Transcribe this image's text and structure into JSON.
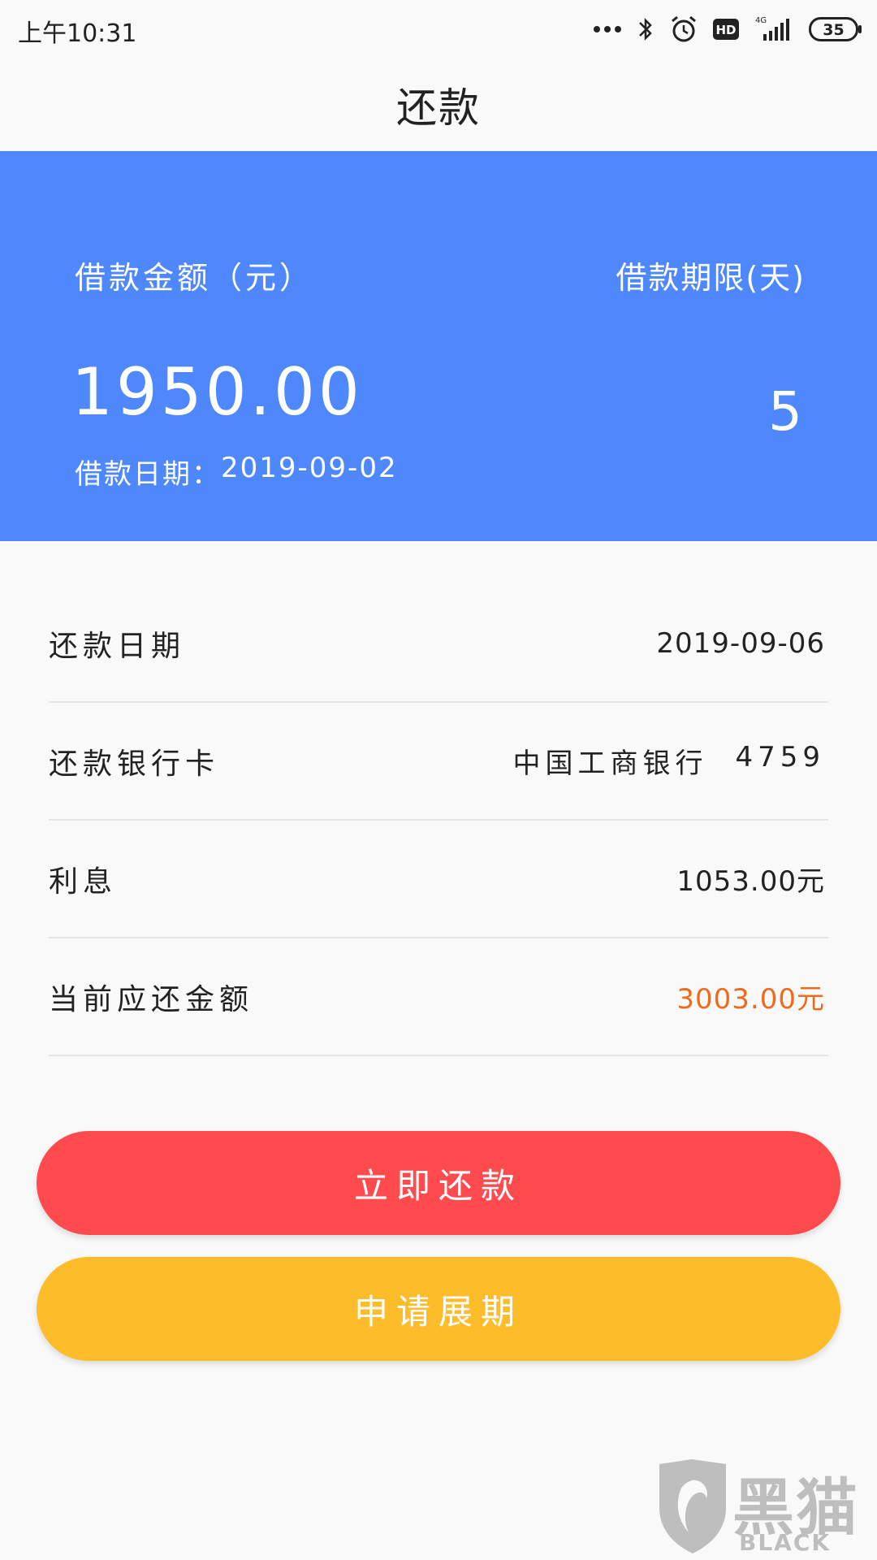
{
  "status_bar": {
    "time": "上午10:31",
    "network": "4G",
    "hd_badge": "HD",
    "battery": "35",
    "icons": [
      "more-dots-icon",
      "bluetooth-icon",
      "alarm-icon",
      "hd-icon",
      "signal-icon",
      "battery-icon"
    ]
  },
  "app_bar": {
    "title": "还款"
  },
  "summary": {
    "amount_label": "借款金额（元）",
    "term_label": "借款期限(天)",
    "amount": "1950.00",
    "term": "5",
    "date_label": "借款日期：",
    "date_value": "2019-09-02",
    "bg_color": "#4e88fc"
  },
  "details": {
    "rows": [
      {
        "label": "还款日期",
        "value": "2019-09-06"
      },
      {
        "label": "还款银行卡",
        "bank": "中国工商银行",
        "card_tail": "4759"
      },
      {
        "label": "利息",
        "value": "1053.00元"
      },
      {
        "label": "当前应还金额",
        "value": "3003.00元",
        "value_color": "#f06a1e"
      }
    ]
  },
  "buttons": {
    "repay_label": "立即还款",
    "repay_color": "#ff4a4e",
    "extend_label": "申请展期",
    "extend_color": "#fdbd2b"
  },
  "watermark": {
    "brand_cn": "黑猫",
    "brand_en": "BLACK CAT"
  }
}
